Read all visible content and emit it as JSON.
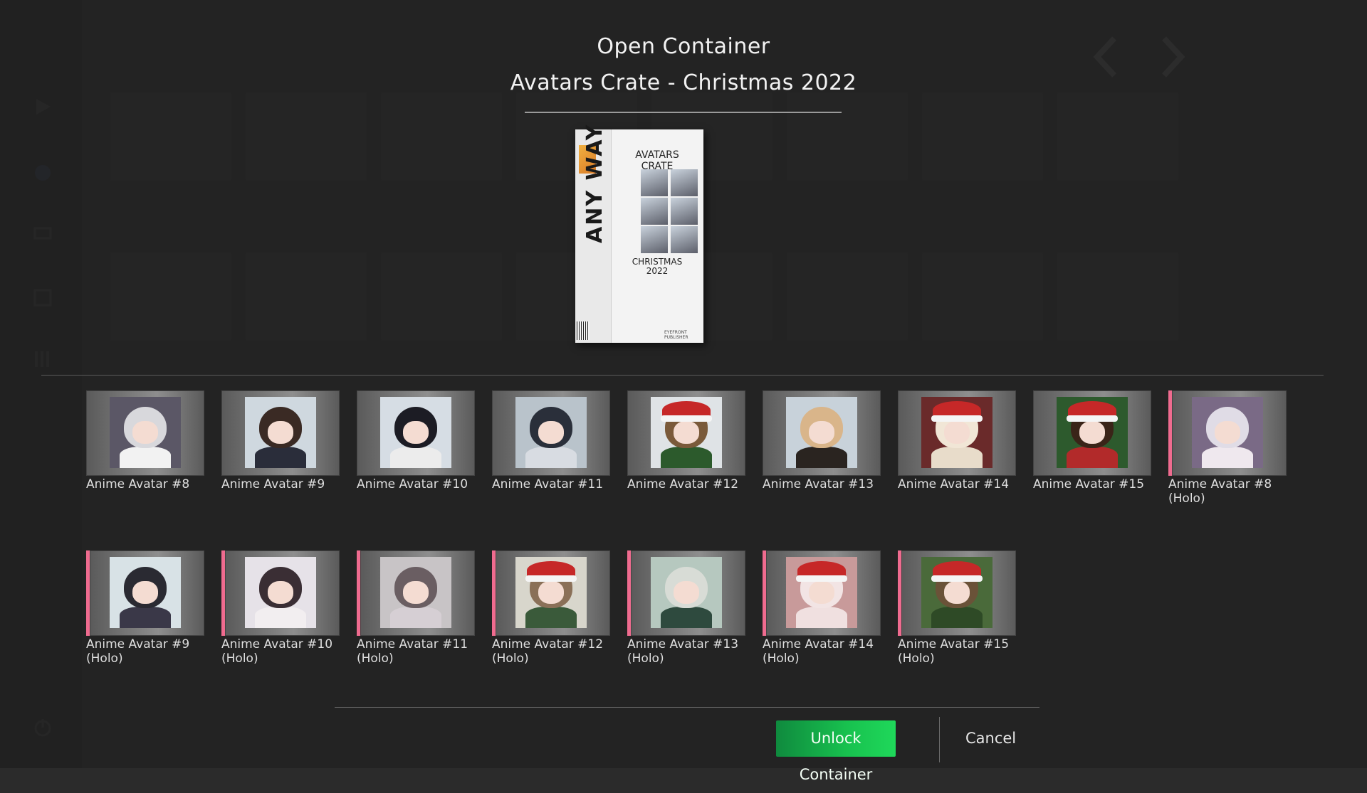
{
  "modal": {
    "title": "Open Container",
    "subtitle": "Avatars Crate - Christmas 2022"
  },
  "crate": {
    "brand": "ANY WAY",
    "name_line1": "AVATARS",
    "name_line2": "CRATE",
    "edition_line1": "CHRISTMAS",
    "edition_line2": "2022",
    "publisher": "EYEFRONT PUBLISHER"
  },
  "items": [
    {
      "label": "Anime Avatar #8",
      "holo": false,
      "hair": "#d8d8dc",
      "outfit": "#f2f2f2",
      "bg": "#5b5766",
      "hat": false
    },
    {
      "label": "Anime Avatar #9",
      "holo": false,
      "hair": "#3a2a24",
      "outfit": "#2a2d3a",
      "bg": "#cfd8df",
      "hat": false
    },
    {
      "label": "Anime Avatar #10",
      "holo": false,
      "hair": "#1c1c24",
      "outfit": "#ececec",
      "bg": "#d6dde4",
      "hat": false
    },
    {
      "label": "Anime Avatar #11",
      "holo": false,
      "hair": "#2a2f3a",
      "outfit": "#d8dce2",
      "bg": "#b9c3cb",
      "hat": false
    },
    {
      "label": "Anime Avatar #12",
      "holo": false,
      "hair": "#7a5a3a",
      "outfit": "#2c5a2c",
      "bg": "#dfe3e6",
      "hat": true
    },
    {
      "label": "Anime Avatar #13",
      "holo": false,
      "hair": "#d9b58a",
      "outfit": "#2a2420",
      "bg": "#c8d2da",
      "hat": false
    },
    {
      "label": "Anime Avatar #14",
      "holo": false,
      "hair": "#f1e6d6",
      "outfit": "#e8dcca",
      "bg": "#6a2a2a",
      "hat": true
    },
    {
      "label": "Anime Avatar #15",
      "holo": false,
      "hair": "#3a2418",
      "outfit": "#b22a2a",
      "bg": "#2d5a2d",
      "hat": true
    },
    {
      "label": "Anime Avatar #8\n(Holo)",
      "holo": true,
      "hair": "#e0dce6",
      "outfit": "#efe8ee",
      "bg": "#7a6a86",
      "hat": false
    },
    {
      "label": "Anime Avatar #9\n(Holo)",
      "holo": true,
      "hair": "#2a2a32",
      "outfit": "#3a3848",
      "bg": "#d8e2e6",
      "hat": false
    },
    {
      "label": "Anime Avatar #10\n(Holo)",
      "holo": true,
      "hair": "#3a2e34",
      "outfit": "#f2eef0",
      "bg": "#e6e2e8",
      "hat": false
    },
    {
      "label": "Anime Avatar #11\n(Holo)",
      "holo": true,
      "hair": "#6a5e62",
      "outfit": "#d6cfd4",
      "bg": "#c8c4c6",
      "hat": false
    },
    {
      "label": "Anime Avatar #12\n(Holo)",
      "holo": true,
      "hair": "#8a7058",
      "outfit": "#3a5a3a",
      "bg": "#d8d6cc",
      "hat": true
    },
    {
      "label": "Anime Avatar #13\n(Holo)",
      "holo": true,
      "hair": "#d8dcd6",
      "outfit": "#2e4a3e",
      "bg": "#b6c8bf",
      "hat": false
    },
    {
      "label": "Anime Avatar #14\n(Holo)",
      "holo": true,
      "hair": "#f2e4e4",
      "outfit": "#f0e0e0",
      "bg": "#c89a9a",
      "hat": true
    },
    {
      "label": "Anime Avatar #15\n(Holo)",
      "holo": true,
      "hair": "#6a5238",
      "outfit": "#2e4a26",
      "bg": "#4a6a3a",
      "hat": true
    }
  ],
  "buttons": {
    "unlock": "Unlock Container",
    "cancel": "Cancel"
  }
}
